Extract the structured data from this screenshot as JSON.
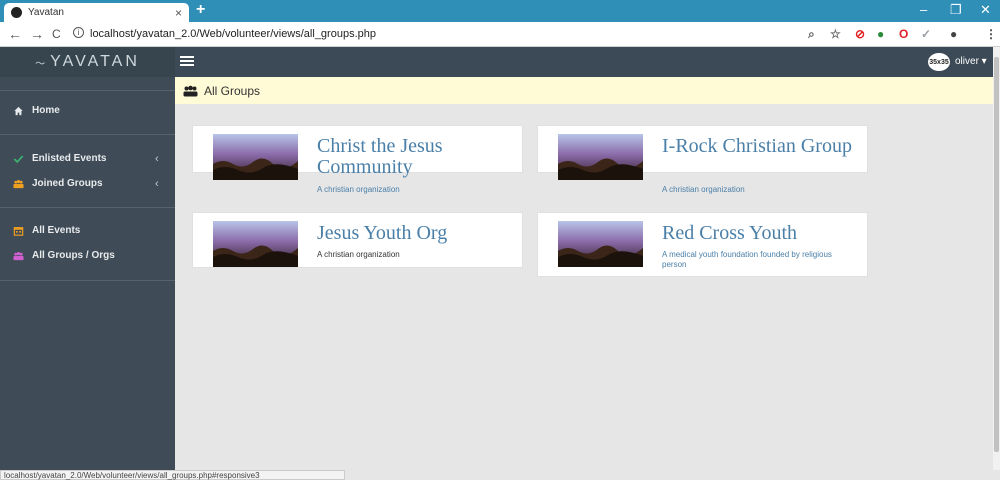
{
  "browser": {
    "tab_title": "Yavatan",
    "tab_close": "×",
    "new_tab": "+",
    "url": "localhost/yavatan_2.0/Web/volunteer/views/all_groups.php",
    "status_url": "localhost/yavatan_2.0/Web/volunteer/views/all_groups.php#responsive3",
    "controls": {
      "minimize": "–",
      "restore": "❐",
      "close": "✕"
    },
    "nav": {
      "back": "←",
      "forward": "→",
      "reload": "C"
    },
    "toolbar_icons": [
      "zoom-icon",
      "bookmark-star-icon",
      "extension-icon",
      "extension-icon",
      "opera-icon",
      "extension-icon",
      "account-icon",
      "menu-icon"
    ]
  },
  "app": {
    "brand": "YAVATAN",
    "avatar_text": "35x35",
    "user_name": "oliver ▾"
  },
  "sidebar": {
    "home": "Home",
    "enlisted_events": "Enlisted Events",
    "joined_groups": "Joined Groups",
    "all_events": "All Events",
    "all_groups": "All Groups / Orgs",
    "caret": "‹"
  },
  "page": {
    "title": "All Groups"
  },
  "groups": [
    {
      "name": "Christ the Jesus Community",
      "description": "A christian organization"
    },
    {
      "name": "I-Rock Christian Group",
      "description": "A christian organization"
    },
    {
      "name": "Jesus Youth Org",
      "description": "A christian organization"
    },
    {
      "name": "Red Cross Youth",
      "description": "A medical youth foundation founded by religious person"
    }
  ],
  "colors": {
    "sidebar": "#3f4c58",
    "header_bg": "#fffbd6",
    "link": "#4a7fa8",
    "browser_bar": "#2f8fb7"
  }
}
